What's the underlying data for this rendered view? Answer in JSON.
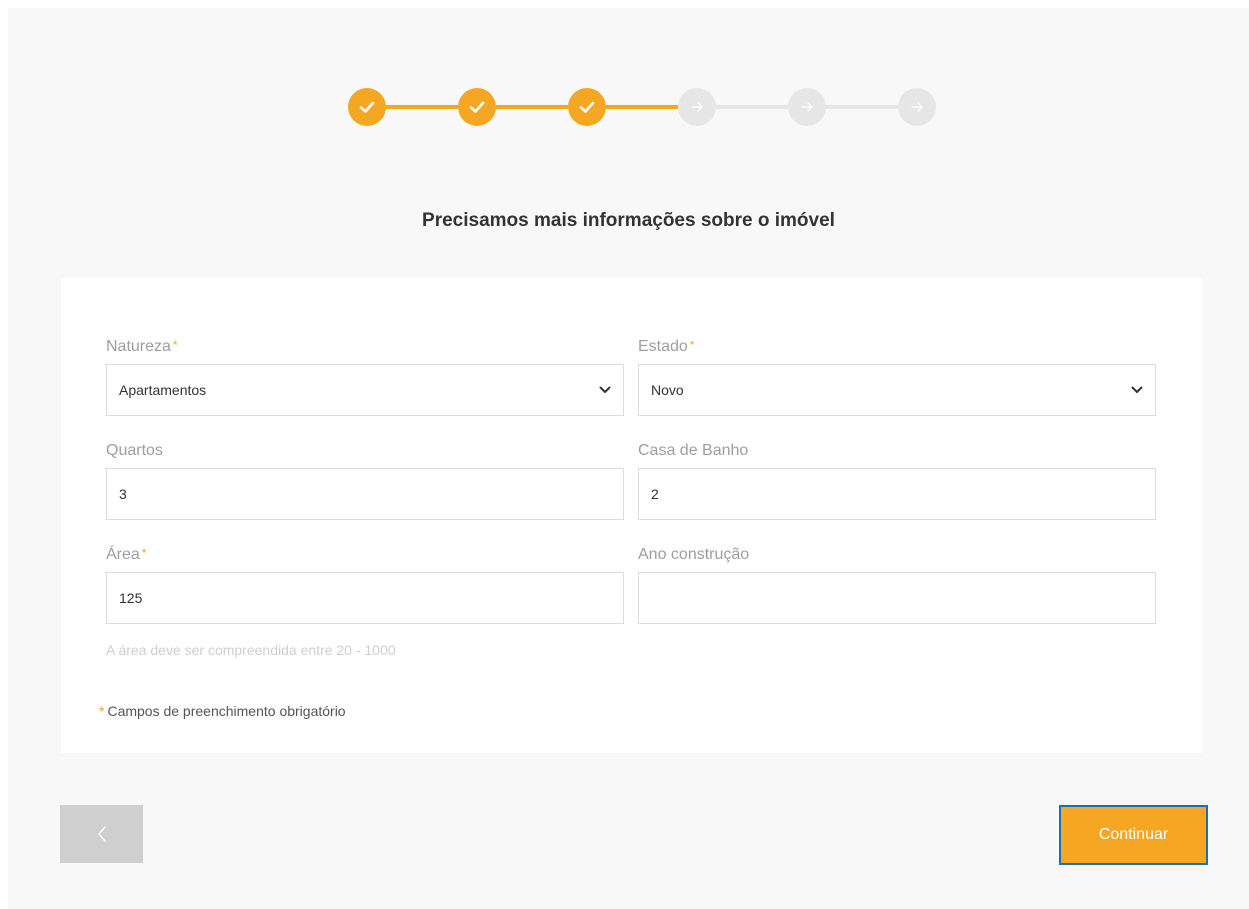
{
  "stepper": {
    "steps": [
      {
        "status": "done",
        "icon": "check-icon"
      },
      {
        "status": "done",
        "icon": "check-icon"
      },
      {
        "status": "done",
        "icon": "check-icon"
      },
      {
        "status": "pending",
        "icon": "arrow-right-icon"
      },
      {
        "status": "pending",
        "icon": "arrow-right-icon"
      },
      {
        "status": "pending",
        "icon": "arrow-right-icon"
      }
    ]
  },
  "title": "Precisamos mais informações sobre o imóvel",
  "form": {
    "natureza": {
      "label": "Natureza",
      "required_mark": "*",
      "value": "Apartamentos"
    },
    "estado": {
      "label": "Estado",
      "required_mark": "*",
      "value": "Novo"
    },
    "quartos": {
      "label": "Quartos",
      "value": "3"
    },
    "casa_banho": {
      "label": "Casa de Banho",
      "value": "2"
    },
    "area": {
      "label": "Área",
      "required_mark": "*",
      "value": "125"
    },
    "ano_construcao": {
      "label": "Ano construção",
      "value": ""
    },
    "area_hint": "A área deve ser compreendida entre 20 - 1000",
    "required_note_mark": "*",
    "required_note": "Campos de preenchimento obrigatório"
  },
  "buttons": {
    "back_icon": "chevron-left-icon",
    "continue_label": "Continuar"
  },
  "colors": {
    "accent": "#f5a623",
    "pending": "#e6e6e6",
    "focus_border": "#1a6fb3"
  }
}
